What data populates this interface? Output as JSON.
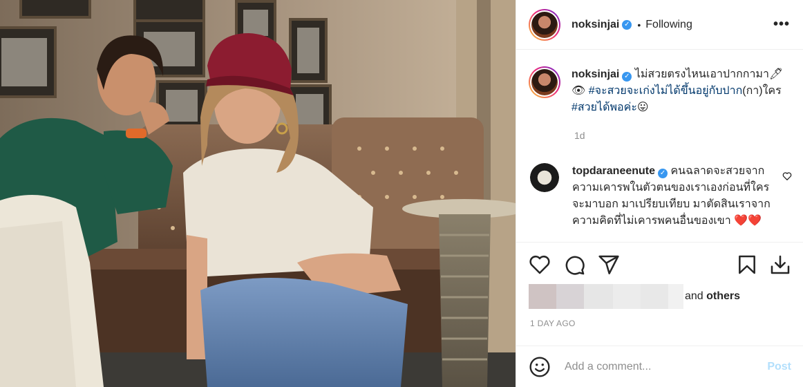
{
  "post": {
    "image_alt": "",
    "header": {
      "username": "noksinjai",
      "separator": "•",
      "follow_status": "Following",
      "more_label": "•••"
    },
    "caption": {
      "username": "noksinjai",
      "line1": "ไม่สวยตรงไหนเอาปากกามา🖊",
      "line2_icon": "👁",
      "hashtag1": "#จะสวยจะเก่งไม่ได้ขึ้นอยู่กับปาก",
      "line2_rest": "(กา)ใคร",
      "hashtag2": "#สวยได้พอค่ะ",
      "line3_emoji": "😛",
      "time": "1d"
    },
    "comment": {
      "username": "topdaraneenute",
      "text": "คนฉลาดจะสวยจากความเคารพในตัวตนของเราเองก่อนที่ใครจะมาบอก มาเปรียบเทียบ มาตัดสินเราจากความคิดที่ไม่เคารพคนอื่นของเขา",
      "emoji": "❤️❤️"
    },
    "actions": {
      "like_icon": "heart-icon",
      "comment_icon": "comment-icon",
      "share_icon": "share-icon",
      "save_icon": "bookmark-icon",
      "download_icon": "download-icon"
    },
    "likes": {
      "suffix_prefix": "and ",
      "suffix_bold": "others"
    },
    "date": "1 DAY AGO",
    "add_comment": {
      "placeholder": "Add a comment...",
      "post_label": "Post"
    }
  },
  "colors": {
    "link": "#00376b",
    "verified": "#3897f0",
    "muted": "#8e8e8e",
    "post_disabled": "#b2dffc"
  }
}
